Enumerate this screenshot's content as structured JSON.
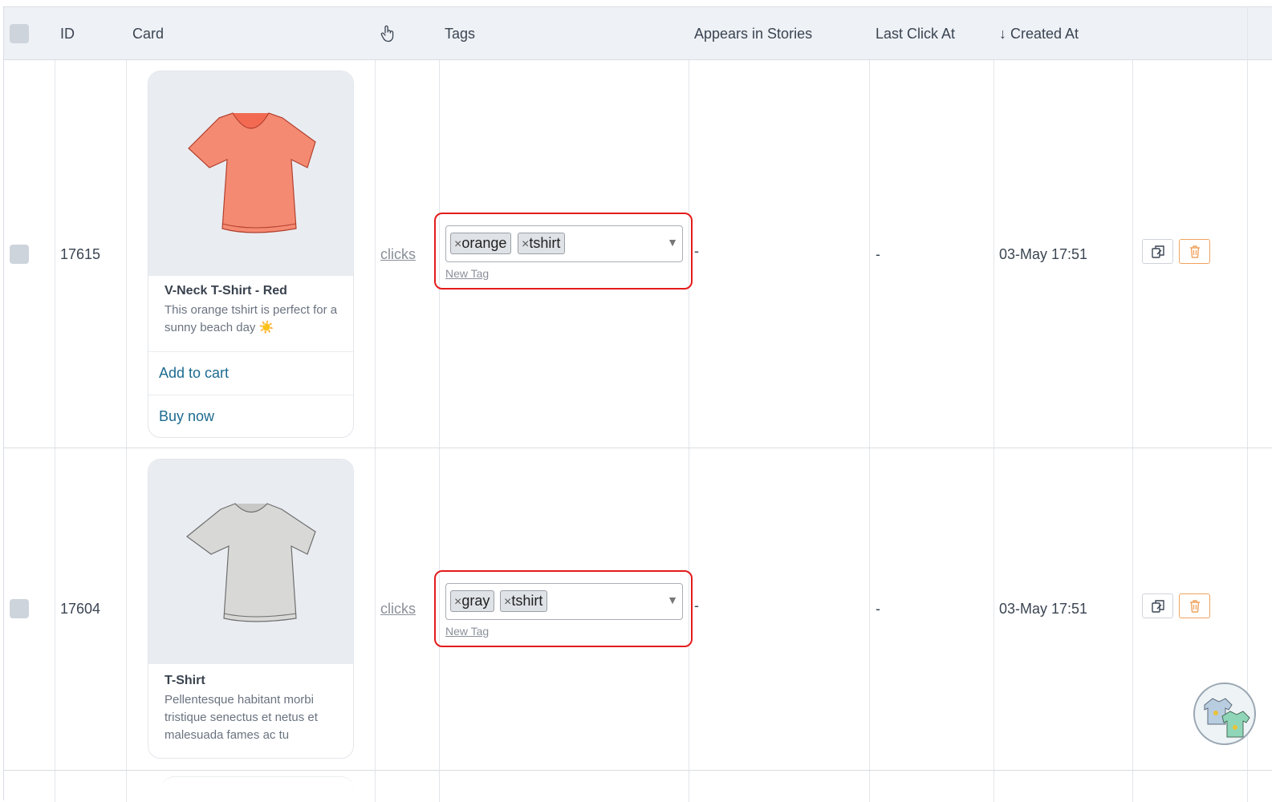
{
  "header": {
    "id_label": "ID",
    "card_label": "Card",
    "tags_label": "Tags",
    "stories_label": "Appears in Stories",
    "last_click_label": "Last Click At",
    "created_label": "↓ Created At"
  },
  "rows": [
    {
      "id": "17615",
      "card": {
        "title": "V-Neck T-Shirt - Red",
        "description": "This orange tshirt is perfect for a sunny beach day ☀️",
        "button1": "Add to cart",
        "button2": "Buy now",
        "shirt_color": "#f58a72"
      },
      "clicks": "clicks",
      "tags": [
        "orange",
        "tshirt"
      ],
      "new_tag": "New Tag",
      "stories": "-",
      "last_click": "-",
      "created": "03-May 17:51"
    },
    {
      "id": "17604",
      "card": {
        "title": "T-Shirt",
        "description": "Pellentesque habitant morbi tristique senectus et netus et malesuada fames ac tu",
        "shirt_color": "#d8d8d6"
      },
      "clicks": "clicks",
      "tags": [
        "gray",
        "tshirt"
      ],
      "new_tag": "New Tag",
      "stories": "-",
      "last_click": "-",
      "created": "03-May 17:51"
    }
  ],
  "colors": {
    "highlight": "#e41b1b",
    "link": "#1d6b8f",
    "delete": "#f0a35e"
  },
  "icons": {
    "header_click": "pointer-hand-icon",
    "copy": "copy-icon",
    "delete": "trash-icon"
  }
}
